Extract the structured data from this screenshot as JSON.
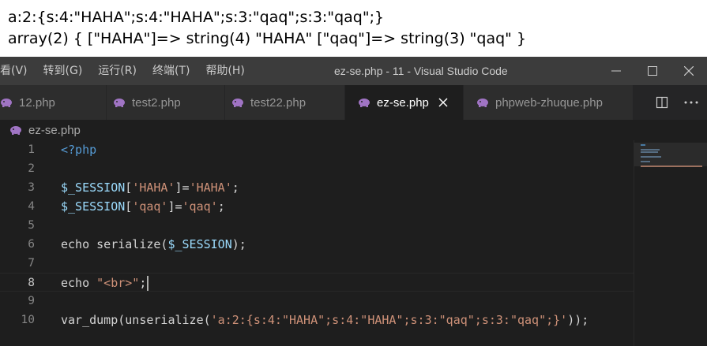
{
  "output": {
    "line1": "a:2:{s:4:\"HAHA\";s:4:\"HAHA\";s:3:\"qaq\";s:3:\"qaq\";}",
    "line2": "array(2) { [\"HAHA\"]=> string(4) \"HAHA\" [\"qaq\"]=> string(3) \"qaq\" }"
  },
  "titlebar": {
    "menu": [
      "看(V)",
      "转到(G)",
      "运行(R)",
      "终端(T)",
      "帮助(H)"
    ],
    "title": "ez-se.php - 11 - Visual Studio Code"
  },
  "tabs": [
    {
      "label": "12.php",
      "active": false
    },
    {
      "label": "test2.php",
      "active": false
    },
    {
      "label": "test22.php",
      "active": false
    },
    {
      "label": "ez-se.php",
      "active": true
    },
    {
      "label": "phpweb-zhuque.php",
      "active": false
    }
  ],
  "breadcrumb": {
    "file": "ez-se.php"
  },
  "editor": {
    "current_line": 8,
    "lines": [
      {
        "num": "1",
        "text": "<?php"
      },
      {
        "num": "2",
        "text": ""
      },
      {
        "num": "3",
        "text": "$_SESSION['HAHA']='HAHA';"
      },
      {
        "num": "4",
        "text": "$_SESSION['qaq']='qaq';"
      },
      {
        "num": "5",
        "text": ""
      },
      {
        "num": "6",
        "text": "echo serialize($_SESSION);"
      },
      {
        "num": "7",
        "text": ""
      },
      {
        "num": "8",
        "text": "echo \"<br>\";"
      },
      {
        "num": "9",
        "text": ""
      },
      {
        "num": "10",
        "text": "var_dump(unserialize('a:2:{s:4:\"HAHA\";s:4:\"HAHA\";s:3:\"qaq\";s:3:\"qaq\";}'));"
      }
    ]
  },
  "icons": {
    "php_file": "php-elephant-icon",
    "minimize": "minimize-icon",
    "maximize": "maximize-icon",
    "close": "close-icon",
    "split_editor": "split-editor-icon",
    "more_actions": "more-actions-icon"
  },
  "colors": {
    "titlebar": "#3c3c3c",
    "editor_bg": "#1e1e1e",
    "php_icon": "#a074c4",
    "keyword": "#569cd6",
    "variable": "#9cdcfe",
    "string": "#ce9178"
  }
}
